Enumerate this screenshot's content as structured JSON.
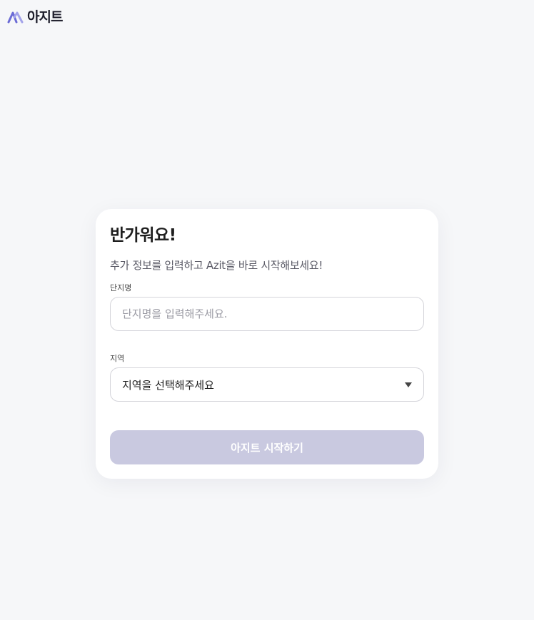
{
  "brand": {
    "name": "아지트",
    "accent": "#6b6bd6",
    "accent_secondary": "#a3a3ea"
  },
  "card": {
    "title": "반가워요!",
    "subtitle": "추가 정보를 입력하고 Azit을 바로 시작해보세요!",
    "complex_name": {
      "label": "단지명",
      "placeholder": "단지명을 입력해주세요.",
      "value": ""
    },
    "region": {
      "label": "지역",
      "selected": "지역을 선택해주세요",
      "icon": "caret-down-icon"
    },
    "submit": {
      "label": "아지트 시작하기",
      "state": "disabled",
      "color": "#c9c9e0"
    }
  }
}
